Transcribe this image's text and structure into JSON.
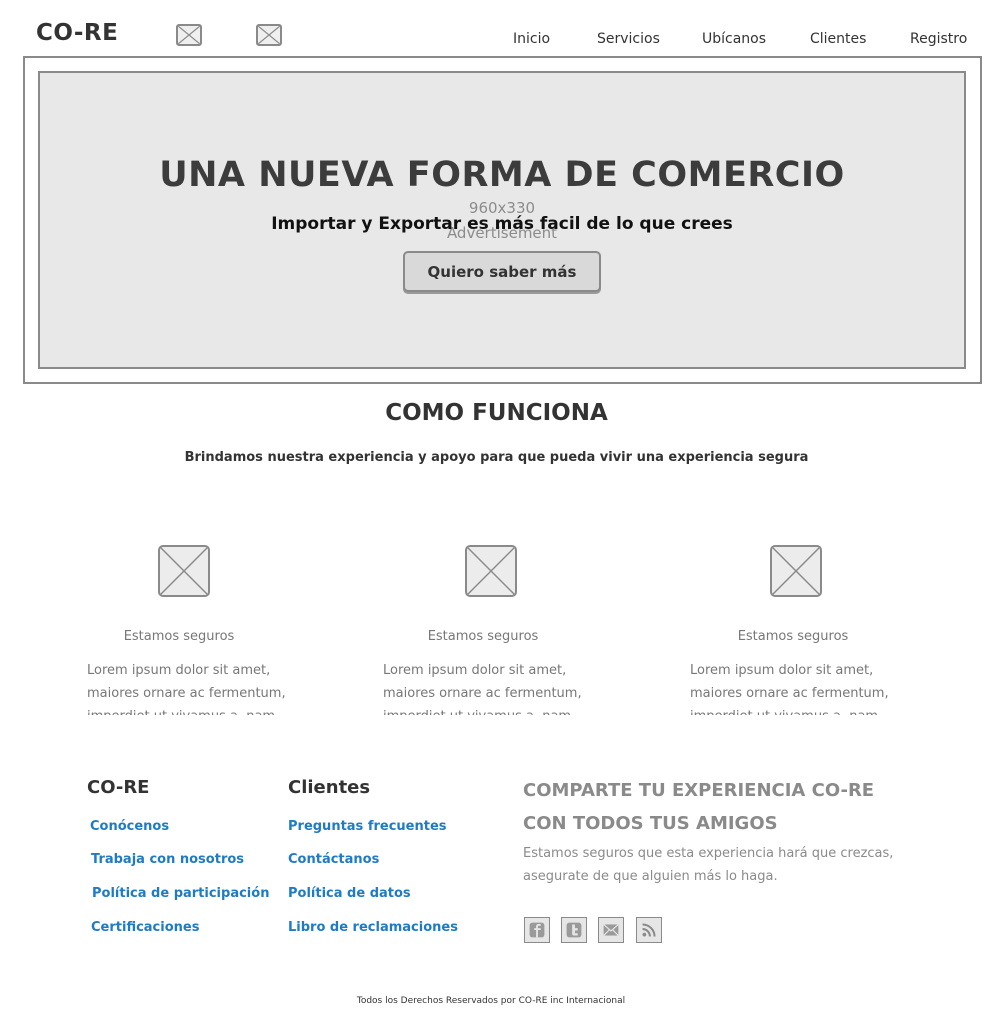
{
  "header": {
    "logo": "CO-RE",
    "nav": [
      "Inicio",
      "Servicios",
      "Ubícanos",
      "Clientes",
      "Registro"
    ]
  },
  "hero": {
    "title": "UNA NUEVA FORMA DE COMERCIO",
    "ad_dimensions": "960x330",
    "ad_label": "Advertisement",
    "subtitle": "Importar y Exportar es más facil de lo que crees",
    "button": "Quiero saber más"
  },
  "how": {
    "title": "COMO FUNCIONA",
    "subtitle": "Brindamos nuestra experiencia y apoyo para que pueda vivir una experiencia segura",
    "features": [
      {
        "title": "Estamos seguros",
        "text": "Lorem ipsum dolor sit amet, maiores ornare ac fermentum, imperdiet ut vivamus a, nam"
      },
      {
        "title": "Estamos seguros",
        "text": "Lorem ipsum dolor sit amet, maiores ornare ac fermentum, imperdiet ut vivamus a, nam"
      },
      {
        "title": "Estamos seguros",
        "text": "Lorem ipsum dolor sit amet, maiores ornare ac fermentum, imperdiet ut vivamus a, nam"
      }
    ]
  },
  "footer": {
    "col1": {
      "title": "CO-RE",
      "links": [
        "Conócenos",
        "Trabaja con nosotros",
        "Política de participación",
        "Certificaciones"
      ]
    },
    "col2": {
      "title": "Clientes",
      "links": [
        "Preguntas frecuentes",
        "Contáctanos",
        "Política de datos",
        "Libro de reclamaciones"
      ]
    },
    "share": {
      "title": "COMPARTE TU EXPERIENCIA CO-RE CON TODOS TUS AMIGOS",
      "text": "Estamos seguros que esta experiencia hará que crezcas, asegurate de que alguien más lo haga.",
      "icons": [
        "facebook-icon",
        "twitter-icon",
        "email-icon",
        "rss-icon"
      ]
    },
    "copyright": "Todos los Derechos Reservados por CO-RE inc Internacional"
  },
  "colors": {
    "link": "#1e7bc4",
    "placeholder_border": "#8a8a8a",
    "hero_bg": "#e8e8e8"
  }
}
